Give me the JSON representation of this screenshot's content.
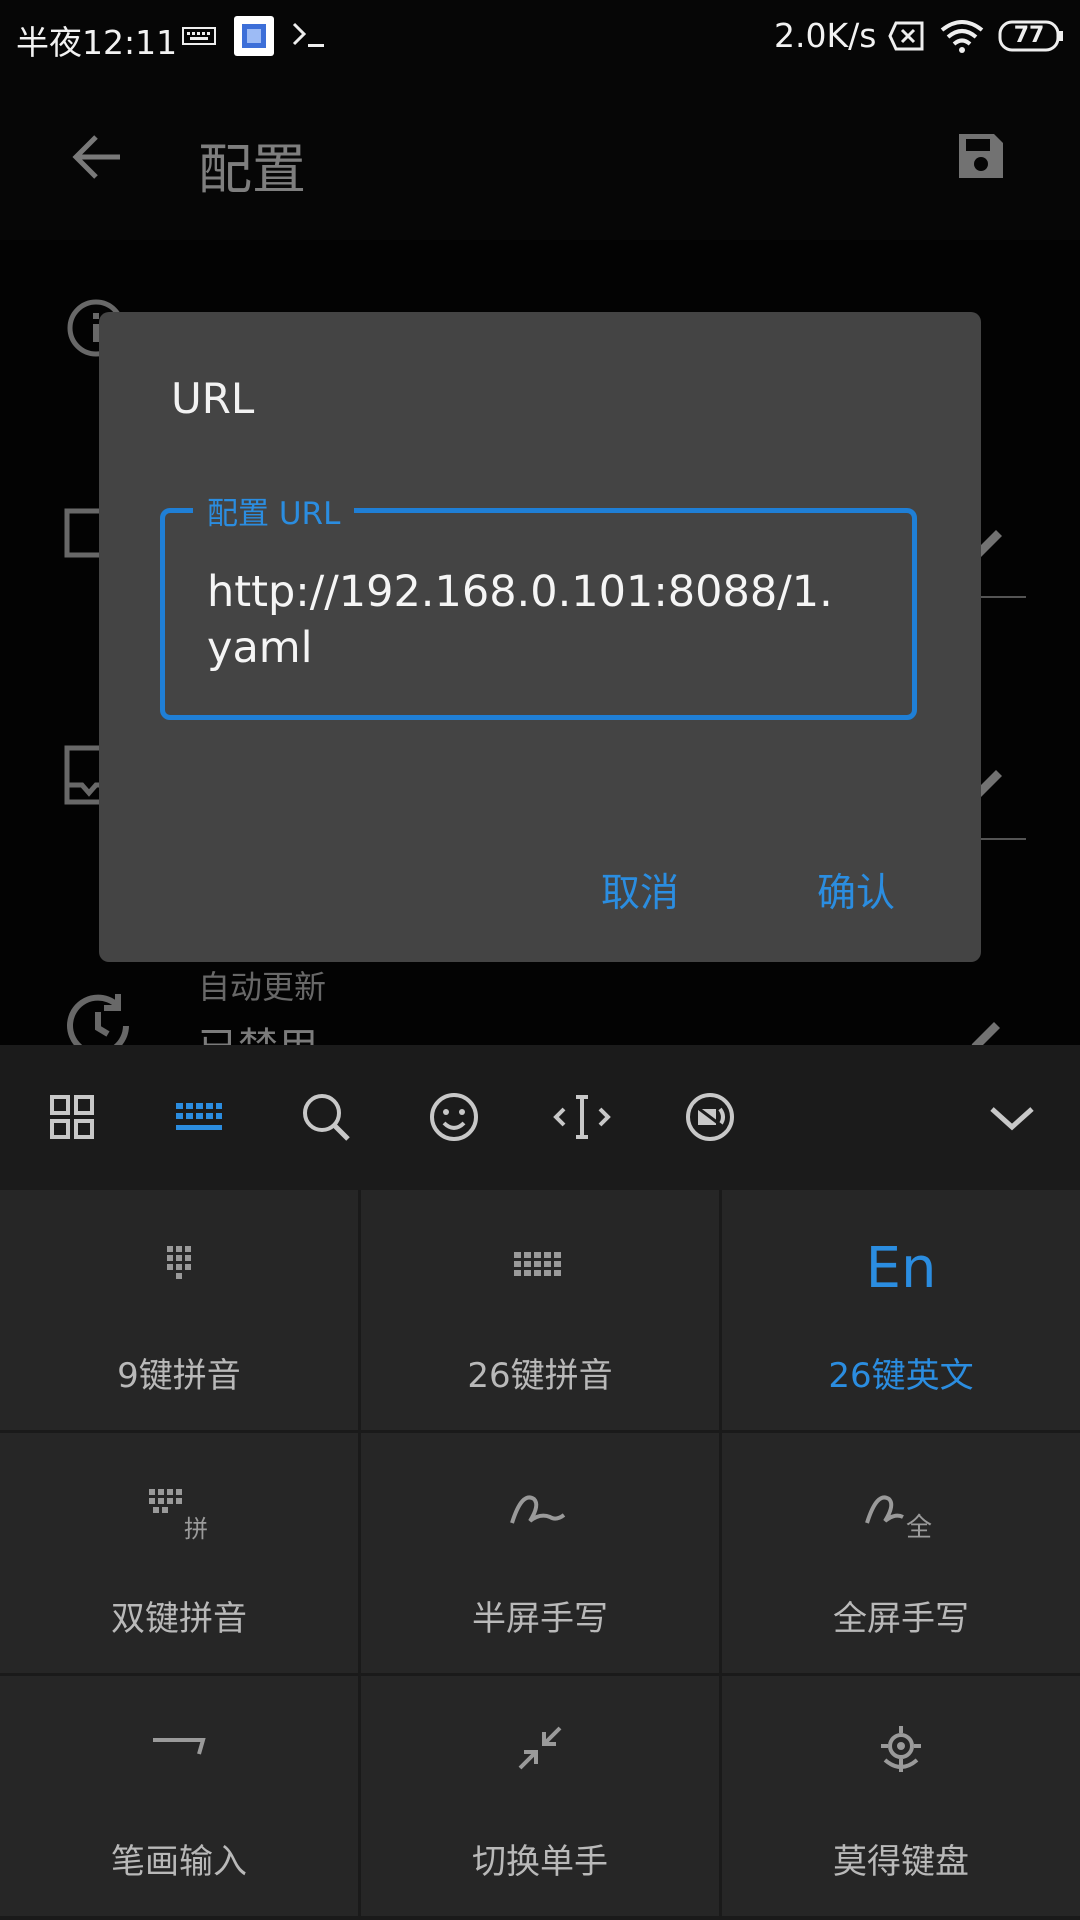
{
  "status_bar": {
    "time": "半夜12:11",
    "net_speed": "2.0K/s",
    "battery": "77"
  },
  "app_bar": {
    "title": "配置"
  },
  "background_list": {
    "auto_update_title": "自动更新",
    "auto_update_value": "已禁用"
  },
  "dialog": {
    "title": "URL",
    "field_label": "配置 URL",
    "field_value": "http://192.168.0.101:8088/1.yaml",
    "cancel_label": "取消",
    "confirm_label": "确认"
  },
  "keyboard": {
    "modes": [
      {
        "label": "9键拼音"
      },
      {
        "label": "26键拼音"
      },
      {
        "label": "26键英文",
        "icon_text": "En"
      },
      {
        "label": "双键拼音",
        "icon_badge": "拼"
      },
      {
        "label": "半屏手写"
      },
      {
        "label": "全屏手写",
        "icon_badge": "全"
      },
      {
        "label": "笔画输入"
      },
      {
        "label": "切换单手"
      },
      {
        "label": "莫得键盘"
      }
    ]
  },
  "colors": {
    "accent": "#2b8de0",
    "dialog_bg": "#444444",
    "keyboard_cell": "#262626"
  }
}
